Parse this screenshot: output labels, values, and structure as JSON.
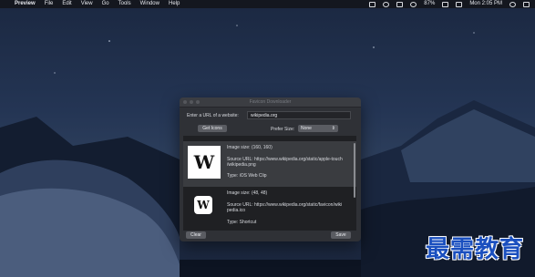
{
  "menubar": {
    "apple_glyph": "",
    "app_name": "Preview",
    "menus": [
      "File",
      "Edit",
      "View",
      "Go",
      "Tools",
      "Window",
      "Help"
    ],
    "battery_percent": "87%",
    "clock": "Mon 2:05 PM"
  },
  "window": {
    "title": "Favicon Downloader",
    "url_label": "Enter a URL of a website:",
    "url_value": "wikipedia.org",
    "get_icons_label": "Get Icons",
    "prefer_size_label": "Prefer Size:",
    "prefer_size_value": "None",
    "clear_label": "Clear",
    "save_label": "Save"
  },
  "icons": [
    {
      "glyph": "W",
      "size_text": "Image size: (160, 160)",
      "source_line1": "Source URL: https://www.wikipedia.org/static/apple-touch",
      "source_line2": "/wikipedia.png",
      "type_text": "Type: iOS Web Clip"
    },
    {
      "glyph": "W",
      "size_text": "Image size: (48, 48)",
      "source_line1": "Source URL: https://www.wikipedia.org/static/favicon/wiki",
      "source_line2": "pedia.ico",
      "type_text": "Type: Shortcut"
    }
  ],
  "watermark": "最需教育"
}
